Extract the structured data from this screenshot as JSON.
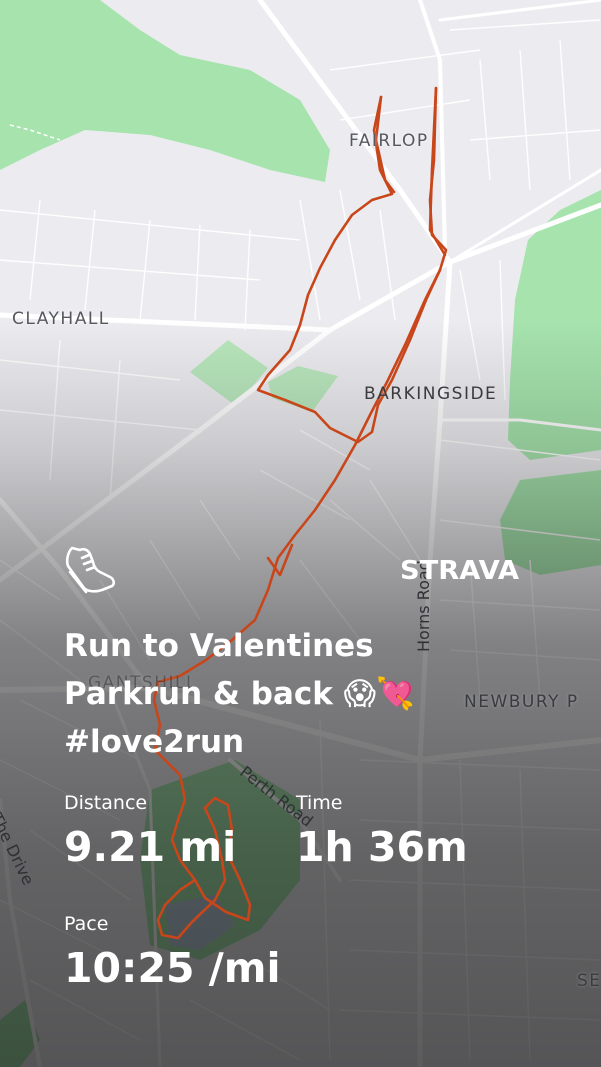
{
  "places": {
    "fairlop": "FAIRLOP",
    "clayhall": "CLAYHALL",
    "barkingside": "BARKINGSIDE",
    "gantshill": "GANTSHILL",
    "newbury_park": "NEWBURY P",
    "seven_kings_partial": "SE"
  },
  "roads": {
    "horns_road": "Horns Road",
    "perth_road": "Perth Road",
    "the_drive": "The Drive"
  },
  "activity": {
    "type_icon": "running-shoe-icon",
    "brand": "STRAVA",
    "title": "Run to Valentines Parkrun & back 😱💘 #love2run",
    "stats": {
      "distance_label": "Distance",
      "distance_value": "9.21 mi",
      "time_label": "Time",
      "time_value": "1h 36m",
      "pace_label": "Pace",
      "pace_value": "10:25 /mi"
    }
  },
  "colors": {
    "route": "#c8461a",
    "park": "#a6e3ad",
    "map_background": "#ececf0",
    "text": "#ffffff"
  }
}
